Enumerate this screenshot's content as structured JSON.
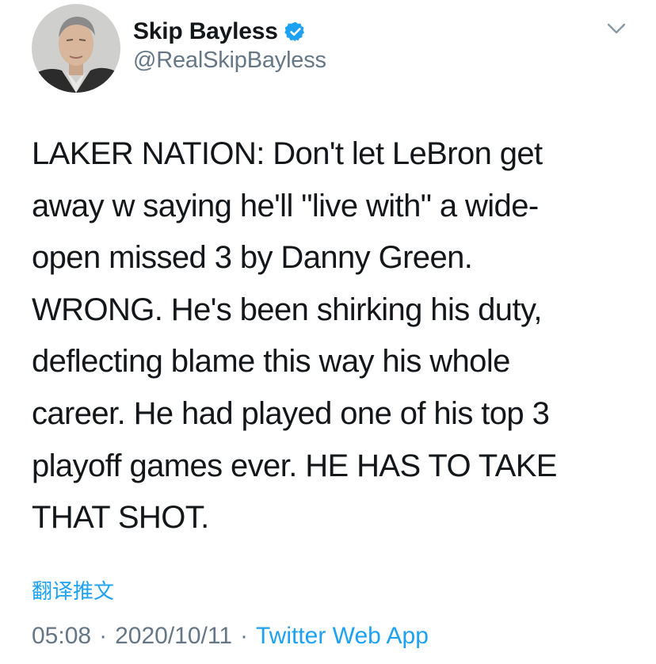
{
  "author": {
    "name": "Skip Bayless",
    "handle": "@RealSkipBayless",
    "verified": true,
    "avatar_icon": "profile-photo"
  },
  "menu_icon": "chevron-down-icon",
  "tweet": {
    "lines": [
      "LAKER NATION: Don't let LeBron get",
      "away w saying he'll \"live with\" a wide-",
      "open missed 3 by Danny Green.",
      "WRONG. He's been shirking his duty,",
      "deflecting blame this way his whole",
      "career. He had played one of his top 3",
      "playoff games ever. HE HAS TO TAKE",
      "THAT SHOT."
    ],
    "translate_label": "翻译推文",
    "time": "05:08",
    "separator": "·",
    "date": "2020/10/11",
    "source": "Twitter Web App"
  },
  "colors": {
    "link": "#1da1f2",
    "secondary": "#657786",
    "text": "#14171a",
    "verified": "#1da1f2"
  }
}
